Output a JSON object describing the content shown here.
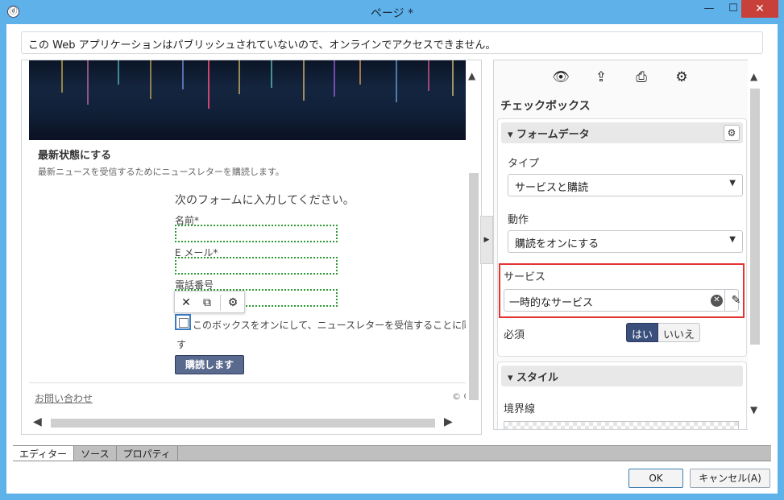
{
  "window": {
    "title": "ページ *",
    "app_icon": "ⓓ",
    "minimize_glyph": "—",
    "maximize_glyph": "☐",
    "close_glyph": "✕"
  },
  "notice": "この Web アプリケーションはパブリッシュされていないので、オンラインでアクセスできません。",
  "editor": {
    "section_title": "最新状態にする",
    "section_desc": "最新ニュースを受信するためにニュースレターを購読します。",
    "form_intro": "次のフォームに入力してください。",
    "fields": [
      {
        "label": "名前*"
      },
      {
        "label": "E メール*"
      },
      {
        "label": "電話番号"
      }
    ],
    "mini_toolbar": {
      "delete": "✕",
      "duplicate": "⧉",
      "settings": "⚙"
    },
    "checkbox_label": "このボックスをオンにして、ニュースレターを受信することに同",
    "checkbox_label_cont": "す",
    "subscribe_button": "購読します",
    "contact_link": "お問い合わせ",
    "copyright": "© C",
    "scroll": {
      "up": "▲",
      "left": "◀",
      "right": "▶"
    }
  },
  "collapse_glyph": "▶",
  "props": {
    "toolbar_icons": [
      "eye-icon",
      "upload-page-icon",
      "save-page-icon",
      "settings-page-icon"
    ],
    "toolbar_glyphs": [
      "👁",
      "⇪",
      "⎙",
      "⚙"
    ],
    "title": "チェックボックス",
    "form_data": {
      "header": "▾ フォームデータ",
      "settings_glyph": "⚙",
      "type_label": "タイプ",
      "type_value": "サービスと購読",
      "action_label": "動作",
      "action_value": "購読をオンにする",
      "service_label": "サービス",
      "service_value": "一時的なサービス",
      "clear_glyph": "✕",
      "edit_glyph": "✎",
      "required_label": "必須",
      "yes": "はい",
      "no": "いいえ",
      "caret": "▼"
    },
    "style": {
      "header": "▾ スタイル",
      "border_label": "境界線"
    },
    "scroll": {
      "up": "▲",
      "down": "▼"
    }
  },
  "tabs": [
    "エディター",
    "ソース",
    "プロパティ"
  ],
  "buttons": {
    "ok": "OK",
    "cancel": "キャンセル(A)"
  }
}
